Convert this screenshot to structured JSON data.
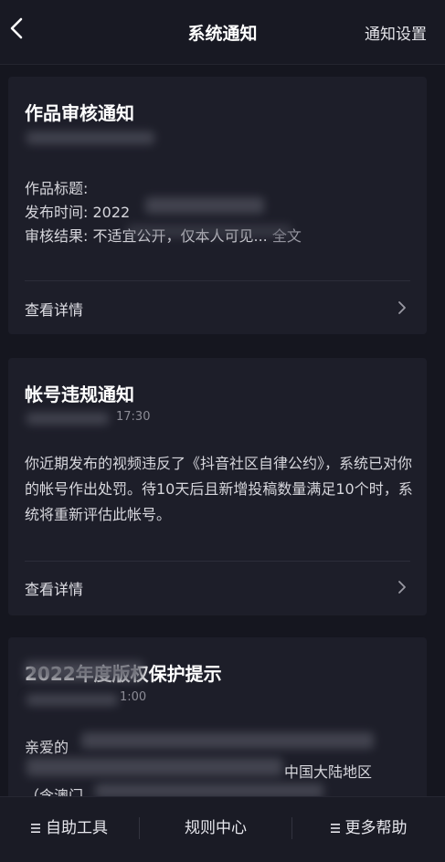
{
  "header": {
    "title": "系统通知",
    "settings_label": "通知设置",
    "back_icon": "chevron-left-icon"
  },
  "cards": [
    {
      "title": "作品审核通知",
      "lines": [
        {
          "label": "作品标题:",
          "value": ""
        },
        {
          "label": "发布时间:",
          "value": "2022"
        },
        {
          "label": "审核结果:",
          "value": "不适宜公开，仅本人可见..."
        }
      ],
      "full_text_link": "全文",
      "detail_label": "查看详情"
    },
    {
      "title": "帐号违规通知",
      "timestamp": "17:30",
      "body": "你近期发布的视频违反了《抖音社区自律公约》，系统已对你的帐号作出处罚。待10天后且新增投稿数量满足10个时，系统将重新评估此帐号。",
      "detail_label": "查看详情"
    },
    {
      "title": "2022年度版权保护提示",
      "timestamp": "1:00",
      "body_lines": [
        "亲爱的",
        "中国大陆地区",
        "（含澳门"
      ]
    }
  ],
  "bottom_bar": {
    "tabs": [
      "自助工具",
      "规则中心",
      "更多帮助"
    ]
  },
  "colors": {
    "background": "#15161f",
    "card": "#1d1e29",
    "text": "#e9e9ee",
    "muted": "#9a9aa4"
  }
}
